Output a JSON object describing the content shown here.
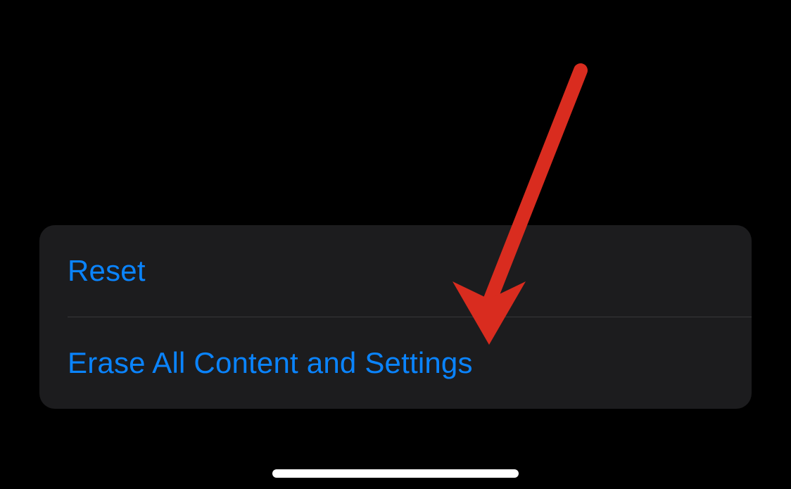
{
  "settings": {
    "items": [
      {
        "label": "Reset"
      },
      {
        "label": "Erase All Content and Settings"
      }
    ]
  },
  "annotation": {
    "type": "arrow",
    "color": "#d92c1f"
  }
}
